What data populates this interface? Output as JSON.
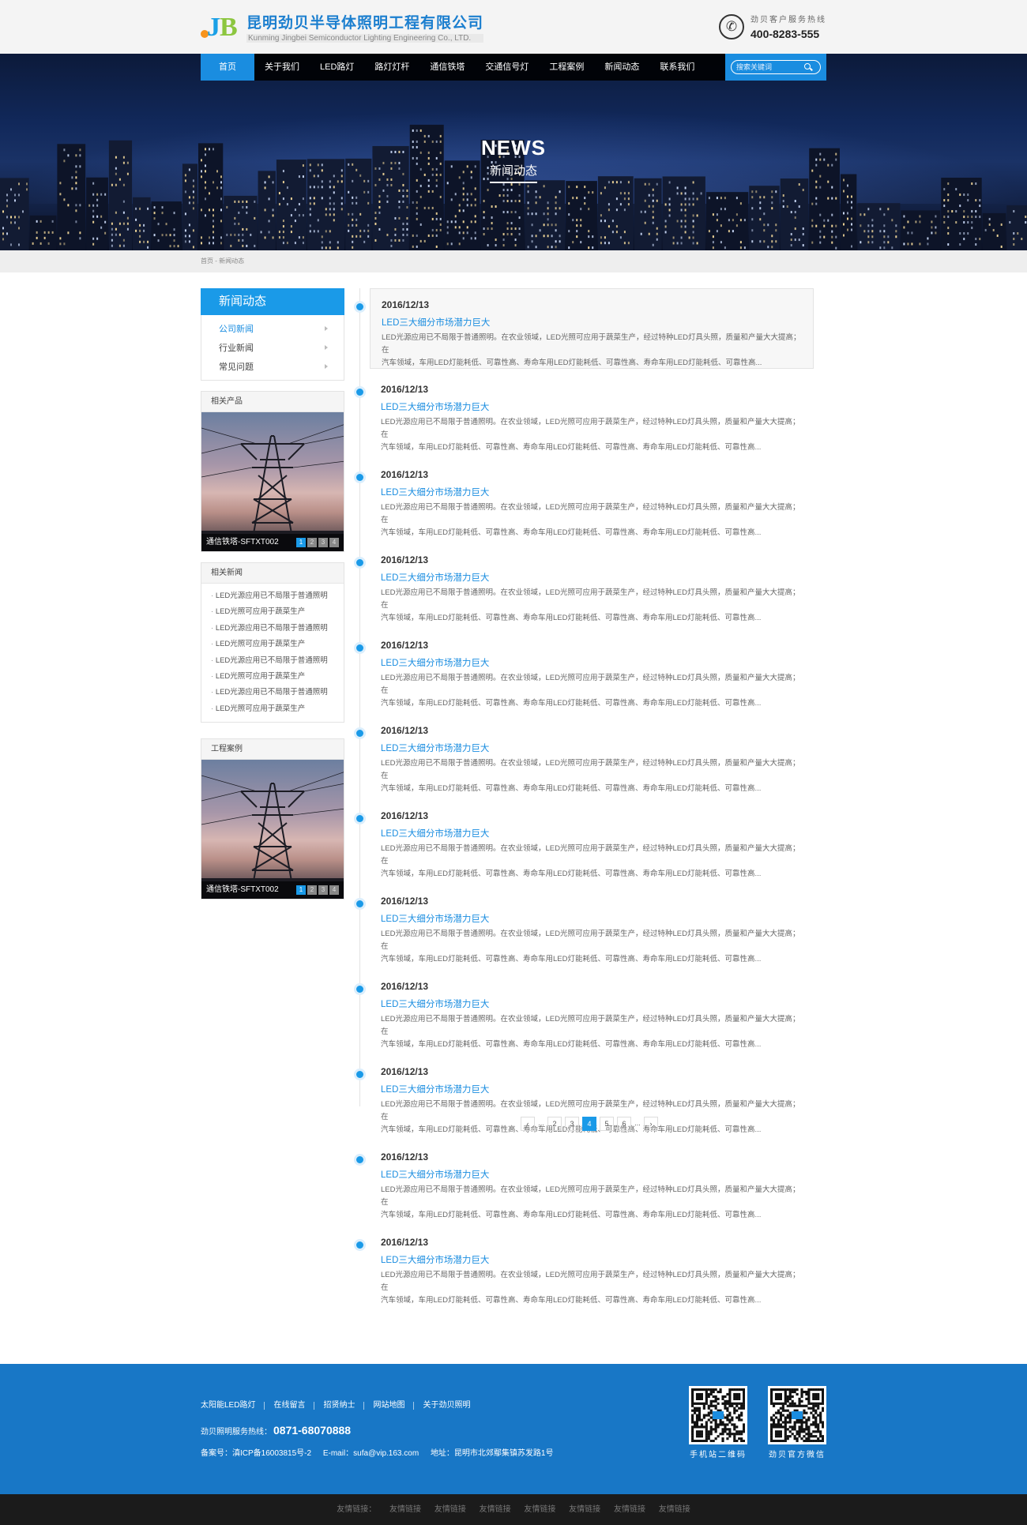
{
  "header": {
    "company_cn": "昆明劲贝半导体照明工程有限公司",
    "company_en": "Kunming Jingbei Semiconductor Lighting Engineering Co., LTD.",
    "hotline_label": "劲贝客户服务热线",
    "hotline_number": "400-8283-555"
  },
  "nav": {
    "items": [
      "首页",
      "关于我们",
      "LED路灯",
      "路灯灯杆",
      "通信铁塔",
      "交通信号灯",
      "工程案例",
      "新闻动态",
      "联系我们"
    ],
    "search_placeholder": "搜索关键词"
  },
  "banner": {
    "title_en": "NEWS",
    "title_cn": "新闻动态"
  },
  "breadcrumb": {
    "text": "首页 - 新闻动态"
  },
  "sidebar": {
    "heading": "新闻动态",
    "menu": [
      "公司新闻",
      "行业新闻",
      "常见问题"
    ],
    "products": {
      "heading": "相关产品",
      "caption": "通信铁塔-SFTXT002",
      "pages": [
        "1",
        "2",
        "3",
        "4"
      ]
    },
    "news": {
      "heading": "相关新闻",
      "items": [
        "LED光源应用已不局限于普通照明",
        "LED光照可应用于蔬菜生产",
        "LED光源应用已不局限于普通照明",
        "LED光照可应用于蔬菜生产",
        "LED光源应用已不局限于普通照明",
        "LED光照可应用于蔬菜生产",
        "LED光源应用已不局限于普通照明",
        "LED光照可应用于蔬菜生产"
      ]
    },
    "cases": {
      "heading": "工程案例",
      "caption": "通信铁塔-SFTXT002",
      "pages": [
        "1",
        "2",
        "3",
        "4"
      ]
    }
  },
  "articles": [
    {
      "date": "2016/12/13",
      "title": "LED三大细分市场潜力巨大",
      "line1": "LED光源应用已不局限于普通照明。在农业领域，LED光照可应用于蔬菜生产，经过特种LED灯具头照，质量和产量大大提高；在",
      "line2": "汽车领域，车用LED灯能耗低、可靠性高、寿命车用LED灯能耗低、可靠性高、寿命车用LED灯能耗低、可靠性高..."
    },
    {
      "date": "2016/12/13",
      "title": "LED三大细分市场潜力巨大",
      "line1": "LED光源应用已不局限于普通照明。在农业领域，LED光照可应用于蔬菜生产，经过特种LED灯具头照，质量和产量大大提高；在",
      "line2": "汽车领域，车用LED灯能耗低、可靠性高、寿命车用LED灯能耗低、可靠性高、寿命车用LED灯能耗低、可靠性高..."
    },
    {
      "date": "2016/12/13",
      "title": "LED三大细分市场潜力巨大",
      "line1": "LED光源应用已不局限于普通照明。在农业领域，LED光照可应用于蔬菜生产，经过特种LED灯具头照，质量和产量大大提高；在",
      "line2": "汽车领域，车用LED灯能耗低、可靠性高、寿命车用LED灯能耗低、可靠性高、寿命车用LED灯能耗低、可靠性高..."
    },
    {
      "date": "2016/12/13",
      "title": "LED三大细分市场潜力巨大",
      "line1": "LED光源应用已不局限于普通照明。在农业领域，LED光照可应用于蔬菜生产，经过特种LED灯具头照，质量和产量大大提高；在",
      "line2": "汽车领域，车用LED灯能耗低、可靠性高、寿命车用LED灯能耗低、可靠性高、寿命车用LED灯能耗低、可靠性高..."
    },
    {
      "date": "2016/12/13",
      "title": "LED三大细分市场潜力巨大",
      "line1": "LED光源应用已不局限于普通照明。在农业领域，LED光照可应用于蔬菜生产，经过特种LED灯具头照，质量和产量大大提高；在",
      "line2": "汽车领域，车用LED灯能耗低、可靠性高、寿命车用LED灯能耗低、可靠性高、寿命车用LED灯能耗低、可靠性高..."
    },
    {
      "date": "2016/12/13",
      "title": "LED三大细分市场潜力巨大",
      "line1": "LED光源应用已不局限于普通照明。在农业领域，LED光照可应用于蔬菜生产，经过特种LED灯具头照，质量和产量大大提高；在",
      "line2": "汽车领域，车用LED灯能耗低、可靠性高、寿命车用LED灯能耗低、可靠性高、寿命车用LED灯能耗低、可靠性高..."
    },
    {
      "date": "2016/12/13",
      "title": "LED三大细分市场潜力巨大",
      "line1": "LED光源应用已不局限于普通照明。在农业领域，LED光照可应用于蔬菜生产，经过特种LED灯具头照，质量和产量大大提高；在",
      "line2": "汽车领域，车用LED灯能耗低、可靠性高、寿命车用LED灯能耗低、可靠性高、寿命车用LED灯能耗低、可靠性高..."
    },
    {
      "date": "2016/12/13",
      "title": "LED三大细分市场潜力巨大",
      "line1": "LED光源应用已不局限于普通照明。在农业领域，LED光照可应用于蔬菜生产，经过特种LED灯具头照，质量和产量大大提高；在",
      "line2": "汽车领域，车用LED灯能耗低、可靠性高、寿命车用LED灯能耗低、可靠性高、寿命车用LED灯能耗低、可靠性高..."
    },
    {
      "date": "2016/12/13",
      "title": "LED三大细分市场潜力巨大",
      "line1": "LED光源应用已不局限于普通照明。在农业领域，LED光照可应用于蔬菜生产，经过特种LED灯具头照，质量和产量大大提高；在",
      "line2": "汽车领域，车用LED灯能耗低、可靠性高、寿命车用LED灯能耗低、可靠性高、寿命车用LED灯能耗低、可靠性高..."
    },
    {
      "date": "2016/12/13",
      "title": "LED三大细分市场潜力巨大",
      "line1": "LED光源应用已不局限于普通照明。在农业领域，LED光照可应用于蔬菜生产，经过特种LED灯具头照，质量和产量大大提高；在",
      "line2": "汽车领域，车用LED灯能耗低、可靠性高、寿命车用LED灯能耗低、可靠性高、寿命车用LED灯能耗低、可靠性高..."
    },
    {
      "date": "2016/12/13",
      "title": "LED三大细分市场潜力巨大",
      "line1": "LED光源应用已不局限于普通照明。在农业领域，LED光照可应用于蔬菜生产，经过特种LED灯具头照，质量和产量大大提高；在",
      "line2": "汽车领域，车用LED灯能耗低、可靠性高、寿命车用LED灯能耗低、可靠性高、寿命车用LED灯能耗低、可靠性高..."
    },
    {
      "date": "2016/12/13",
      "title": "LED三大细分市场潜力巨大",
      "line1": "LED光源应用已不局限于普通照明。在农业领域，LED光照可应用于蔬菜生产，经过特种LED灯具头照，质量和产量大大提高；在",
      "line2": "汽车领域，车用LED灯能耗低、可靠性高、寿命车用LED灯能耗低、可靠性高、寿命车用LED灯能耗低、可靠性高..."
    }
  ],
  "pager": {
    "prev": "‹",
    "next": "›",
    "ellipsis": "...",
    "pages": [
      "2",
      "3",
      "4",
      "5",
      "6"
    ],
    "current": "4"
  },
  "footer": {
    "links": [
      "太阳能LED路灯",
      "在线留言",
      "招贤纳士",
      "网站地图",
      "关于劲贝照明"
    ],
    "hotline_label": "劲贝照明服务热线：",
    "hotline_number": "0871-68070888",
    "icp": "备案号：滇ICP备16003815号-2",
    "email": "E-mail：sufa@vip.163.com",
    "address": "地址：昆明市北郊鄢集镇苏发路1号",
    "qr_mobile": "手机站二维码",
    "qr_wechat": "劲贝官方微信",
    "friend_label": "友情链接：",
    "friend_links": [
      "友情链接",
      "友情链接",
      "友情链接",
      "友情链接",
      "友情链接",
      "友情链接",
      "友情链接"
    ]
  },
  "colors": {
    "accent": "#1a9ae8",
    "nav_active": "#1a8de0",
    "footer_bg": "#1877c6",
    "bottom_bar": "#1b1b1b"
  }
}
